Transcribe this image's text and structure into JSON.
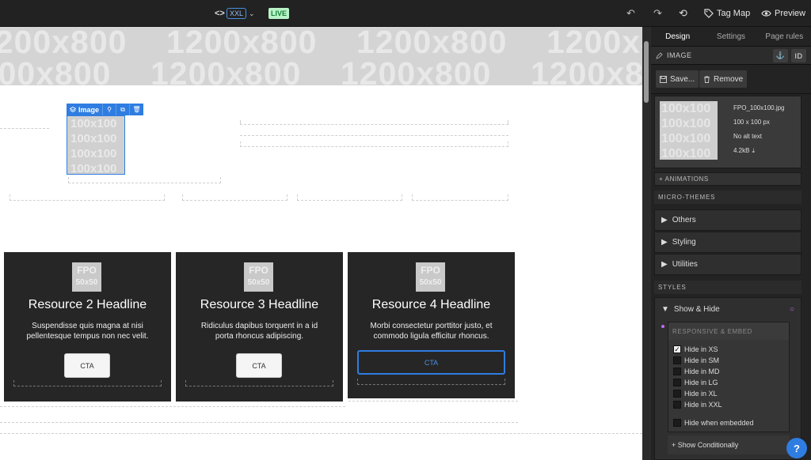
{
  "topbar": {
    "code_icon": "<>",
    "breakpoint": "XXL",
    "chevron": "⌄",
    "live_badge": "LIVE",
    "undo_icon": "↶",
    "redo_icon": "↷",
    "history_icon": "⟲",
    "tag_map_label": "Tag Map",
    "preview_label": "Preview"
  },
  "canvas": {
    "hero_placeholder": "1200x800",
    "image_toolbar": {
      "label": "Image"
    },
    "selected_image_placeholder": "100x100",
    "cards": [
      {
        "fpo_top": "FPO",
        "fpo_bottom": "50x50",
        "headline": "Resource 2 Headline",
        "description": "Suspendisse quis magna at nisi pellentesque tempus non nec velit.",
        "cta": "CTA",
        "cta_selected": false
      },
      {
        "fpo_top": "FPO",
        "fpo_bottom": "50x50",
        "headline": "Resource 3 Headline",
        "description": "Ridiculus dapibus torquent in a id porta rhoncus adipiscing.",
        "cta": "CTA",
        "cta_selected": false
      },
      {
        "fpo_top": "FPO",
        "fpo_bottom": "50x50",
        "headline": "Resource 4 Headline",
        "description": "Morbi consectetur porttitor justo, et commodo ligula efficitur rhoncus.",
        "cta": "CTA",
        "cta_selected": true
      }
    ]
  },
  "panel": {
    "tabs": [
      {
        "label": "Design",
        "active": true
      },
      {
        "label": "Settings",
        "active": false
      },
      {
        "label": "Page rules",
        "active": false
      }
    ],
    "element_type": "IMAGE",
    "anchor_icon": "⚓",
    "id_button": "ID",
    "save_label": "Save...",
    "remove_label": "Remove",
    "image_info": {
      "thumb_placeholder": "100x100",
      "filename": "FPO_100x100.jpg",
      "dimensions": "100 x 100 px",
      "alt_text": "No alt text",
      "file_size": "4.2kB"
    },
    "animations_label": "+ ANIMATIONS",
    "micro_themes_label": "MICRO-THEMES",
    "micro_themes": [
      "Others",
      "Styling",
      "Utilities"
    ],
    "styles_label": "STYLES",
    "show_hide": {
      "title": "Show & Hide",
      "responsive_label": "RESPONSIVE & EMBED",
      "options": [
        {
          "label": "Hide in XS",
          "checked": true
        },
        {
          "label": "Hide in SM",
          "checked": false
        },
        {
          "label": "Hide in MD",
          "checked": false
        },
        {
          "label": "Hide in LG",
          "checked": false
        },
        {
          "label": "Hide in XL",
          "checked": false
        },
        {
          "label": "Hide in XXL",
          "checked": false
        }
      ],
      "embedded_option": {
        "label": "Hide when embedded",
        "checked": false
      },
      "show_conditionally_label": "+ Show Conditionally"
    },
    "help_label": "?"
  },
  "colors": {
    "accent": "#2f7de1",
    "live_bg": "#b9f3c8",
    "card_bg": "#262626",
    "panel_bg": "#232323"
  }
}
